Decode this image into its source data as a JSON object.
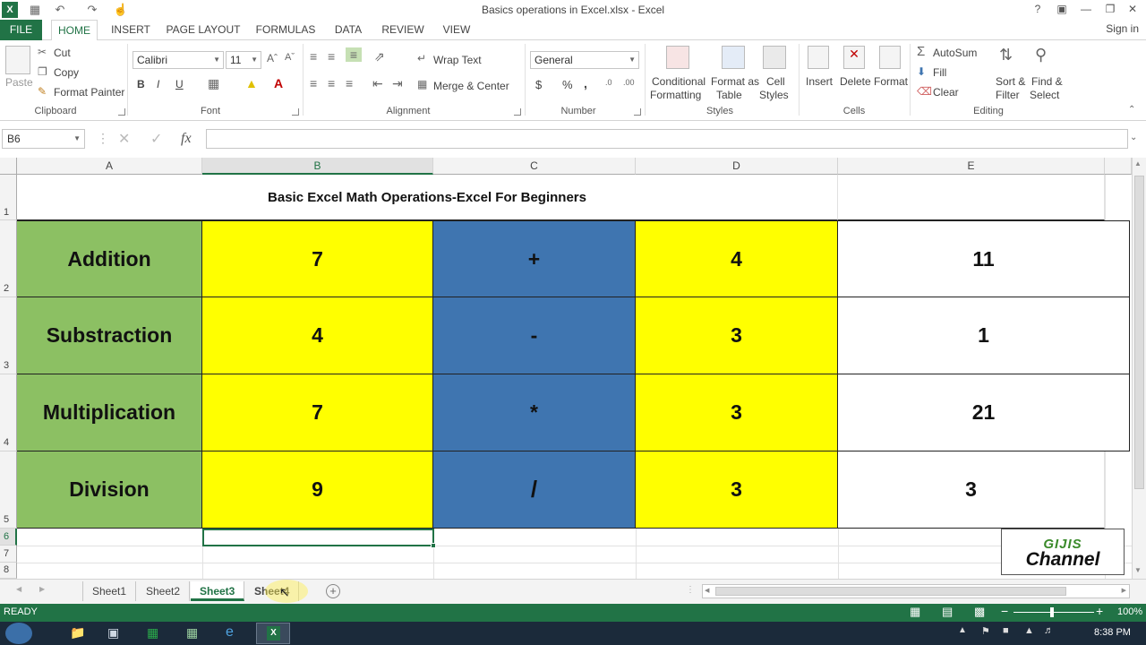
{
  "window": {
    "title": "Basics operations in Excel.xlsx - Excel",
    "signin": "Sign in"
  },
  "tabs": [
    "FILE",
    "HOME",
    "INSERT",
    "PAGE LAYOUT",
    "FORMULAS",
    "DATA",
    "REVIEW",
    "VIEW"
  ],
  "ribbon": {
    "clipboard": {
      "label": "Clipboard",
      "paste": "Paste",
      "cut": "Cut",
      "copy": "Copy",
      "format_painter": "Format Painter"
    },
    "font": {
      "label": "Font",
      "name": "Calibri",
      "size": "11",
      "bold": "B",
      "italic": "I",
      "underline": "U"
    },
    "alignment": {
      "label": "Alignment",
      "wrap": "Wrap Text",
      "merge": "Merge & Center"
    },
    "number": {
      "label": "Number",
      "format": "General",
      "currency": "$",
      "percent": "%",
      "comma": ","
    },
    "styles": {
      "label": "Styles",
      "conditional_1": "Conditional",
      "conditional_2": "Formatting",
      "format_table_1": "Format as",
      "format_table_2": "Table",
      "cell_styles_1": "Cell",
      "cell_styles_2": "Styles"
    },
    "cells": {
      "label": "Cells",
      "insert": "Insert",
      "delete": "Delete",
      "format": "Format"
    },
    "editing": {
      "label": "Editing",
      "autosum": "AutoSum",
      "fill": "Fill",
      "clear": "Clear",
      "sort_1": "Sort &",
      "sort_2": "Filter",
      "find_1": "Find &",
      "find_2": "Select"
    }
  },
  "formula_bar": {
    "name_box": "B6",
    "fx": "fx",
    "value": ""
  },
  "columns": [
    "A",
    "B",
    "C",
    "D",
    "E"
  ],
  "rows": [
    "1",
    "2",
    "3",
    "4",
    "5",
    "6",
    "7",
    "8"
  ],
  "sheet": {
    "title": "Basic Excel Math Operations-Excel For Beginners",
    "operations": [
      {
        "name": "Addition",
        "a": "7",
        "op": "+",
        "b": "4",
        "result": "11"
      },
      {
        "name": "Substraction",
        "a": "4",
        "op": "-",
        "b": "3",
        "result": "1"
      },
      {
        "name": "Multiplication",
        "a": "7",
        "op": "*",
        "b": "3",
        "result": "21"
      },
      {
        "name": "Division",
        "a": "9",
        "op": "/",
        "b": "3",
        "result": "3"
      }
    ]
  },
  "watermark": {
    "line1": "GIJIS",
    "line2": "Channel"
  },
  "sheet_tabs": [
    "Sheet1",
    "Sheet2",
    "Sheet3",
    "Sheet4"
  ],
  "active_sheet": "Sheet3",
  "status": {
    "mode": "READY",
    "zoom": "100%"
  },
  "taskbar": {
    "time": "8:38 PM"
  },
  "colors": {
    "green_label": "#8cc063",
    "yellow": "#ffff00",
    "blue": "#3f75b0",
    "excel_green": "#217346"
  }
}
